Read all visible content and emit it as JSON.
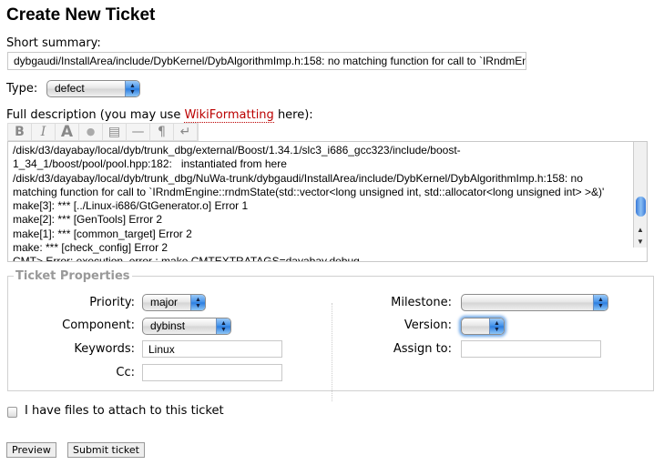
{
  "title": "Create New Ticket",
  "summary": {
    "label": "Short summary:",
    "value": "dybgaudi/InstallArea/include/DybKernel/DybAlgorithmImp.h:158: no matching function for call to `IRndmEngine::rndmState"
  },
  "type": {
    "label": "Type:",
    "value": "defect"
  },
  "description": {
    "label_prefix": "Full description (you may use ",
    "link": "WikiFormatting",
    "label_suffix": " here):",
    "toolbar": [
      {
        "icon": "bold-icon",
        "glyph": "B"
      },
      {
        "icon": "italic-icon",
        "glyph": "I"
      },
      {
        "icon": "heading-icon",
        "glyph": "A"
      },
      {
        "icon": "link-icon",
        "glyph": "●"
      },
      {
        "icon": "code-block-icon",
        "glyph": "▤"
      },
      {
        "icon": "horizontal-rule-icon",
        "glyph": "—"
      },
      {
        "icon": "paragraph-icon",
        "glyph": "¶"
      },
      {
        "icon": "line-break-icon",
        "glyph": "↵"
      }
    ],
    "value": "/disk/d3/dayabay/local/dyb/trunk_dbg/external/Boost/1.34.1/slc3_i686_gcc323/include/boost-\n1_34_1/boost/pool/pool.hpp:182:   instantiated from here\n/disk/d3/dayabay/local/dyb/trunk_dbg/NuWa-trunk/dybgaudi/InstallArea/include/DybKernel/DybAlgorithmImp.h:158: no\nmatching function for call to `IRndmEngine::rndmState(std::vector<long unsigned int, std::allocator<long unsigned int> >&)'\nmake[3]: *** [../Linux-i686/GtGenerator.o] Error 1\nmake[2]: *** [GenTools] Error 2\nmake[1]: *** [common_target] Error 2\nmake: *** [check_config] Error 2\nCMT> Error: execution_error : make CMTEXTRATAGS=dayabay,debug\n### start env dump ###"
  },
  "properties": {
    "legend": "Ticket Properties",
    "priority": {
      "label": "Priority:",
      "value": "major"
    },
    "component": {
      "label": "Component:",
      "value": "dybinst"
    },
    "keywords": {
      "label": "Keywords:",
      "value": "Linux"
    },
    "cc": {
      "label": "Cc:",
      "value": ""
    },
    "milestone": {
      "label": "Milestone:",
      "value": ""
    },
    "version": {
      "label": "Version:",
      "value": ""
    },
    "assign": {
      "label": "Assign to:",
      "value": ""
    }
  },
  "attach": {
    "label": "I have files to attach to this ticket",
    "checked": false
  },
  "buttons": {
    "preview": "Preview",
    "submit": "Submit ticket"
  },
  "colors": {
    "link": "#bb0000",
    "legend": "#999999"
  }
}
